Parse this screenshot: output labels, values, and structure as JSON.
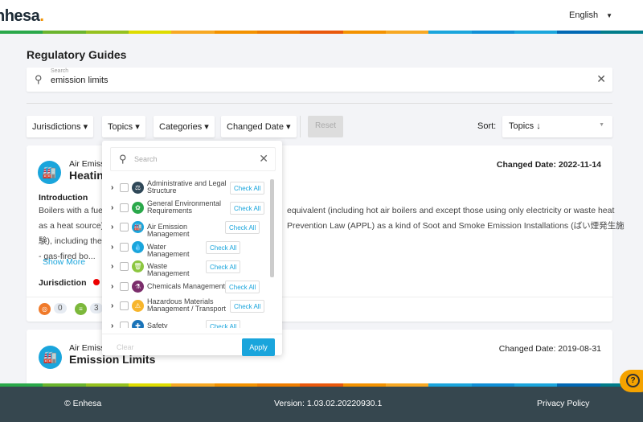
{
  "header": {
    "logo": "Enhesa",
    "language": "English"
  },
  "brand_colors": [
    "#2aa84a",
    "#6ab42d",
    "#95c11f",
    "#dedc00",
    "#f7a823",
    "#f39200",
    "#ee7d00",
    "#e9580c",
    "#f39200",
    "#f7a823",
    "#1aa5dc",
    "#0f8fd6",
    "#1aa5dc",
    "#0068b4",
    "#007c8a"
  ],
  "page": {
    "title": "Regulatory Guides"
  },
  "search": {
    "label": "Search",
    "value": "emission limits"
  },
  "filters": {
    "jurisdictions": "Jurisdictions",
    "topics": "Topics",
    "categories": "Categories",
    "changed_date": "Changed Date",
    "reset": "Reset",
    "sort_label": "Sort:",
    "sort_value": "Topics ↓"
  },
  "topics_dropdown": {
    "search_placeholder": "Search",
    "check_all": "Check All",
    "clear": "Clear",
    "apply": "Apply",
    "items": [
      {
        "label": "Administrative and Legal Structure",
        "color": "#2f4858"
      },
      {
        "label": "General Environmental Requirements",
        "color": "#2aa84a"
      },
      {
        "label": "Air Emission Management",
        "color": "#1aa5dc"
      },
      {
        "label": "Water Management",
        "color": "#1aa5dc"
      },
      {
        "label": "Waste Management",
        "color": "#8cc63f"
      },
      {
        "label": "Chemicals Management",
        "color": "#7b2d6b"
      },
      {
        "label": "Hazardous Materials Management / Transport",
        "color": "#f7b52c"
      },
      {
        "label": "Safety Management",
        "color": "#1a73b8"
      }
    ]
  },
  "results": [
    {
      "topic": "Air Emiss",
      "title": "Heatin",
      "changed_date": "Changed Date: 2022-11-14",
      "intro_heading": "Introduction",
      "body_left": [
        "Boilers with a fuel",
        "as a heat source) a",
        "験), including the f",
        "- gas-fired bo..."
      ],
      "body_right": [
        "equivalent (including hot air boilers and except those using only electricity or waste heat",
        "Prevention Law (APPL) as a kind of Soot and Smoke Emission Installations (ばい煙発生施"
      ],
      "show_more": "Show More",
      "jurisdiction_label": "Jurisdiction",
      "count_a": "0",
      "count_b": "3"
    },
    {
      "topic": "Air Emiss",
      "title": "Emission Limits",
      "changed_date": "Changed Date: 2019-08-31"
    }
  ],
  "footer": {
    "copyright": "© Enhesa",
    "version": "Version: 1.03.02.20220930.1",
    "privacy": "Privacy Policy"
  }
}
